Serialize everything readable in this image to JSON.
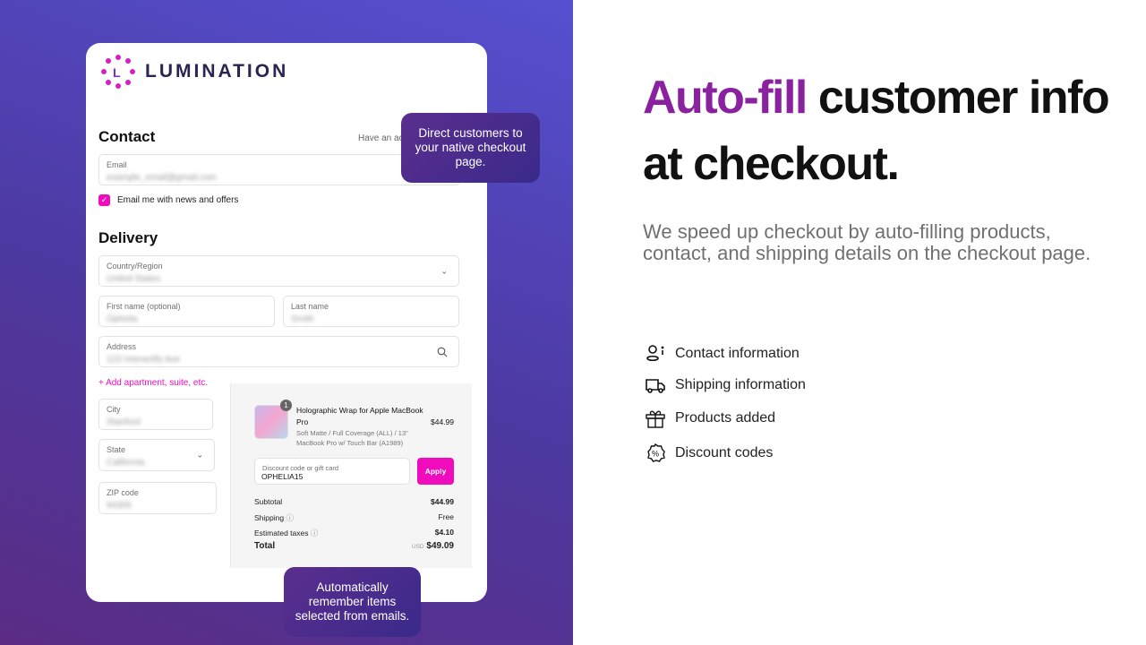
{
  "brand": {
    "name": "LUMINATION",
    "color": "#e020c8"
  },
  "checkout": {
    "contact_title": "Contact",
    "have_account": "Have an ac",
    "email": {
      "label": "Email",
      "value": "example_email@gmail.com"
    },
    "newsletter": {
      "label": "Email me with news and offers",
      "checked": true
    },
    "delivery_title": "Delivery",
    "country": {
      "label": "Country/Region",
      "value": "United States"
    },
    "first_name": {
      "label": "First name (optional)",
      "value": "Ophelia"
    },
    "last_name": {
      "label": "Last name",
      "value": "Smith"
    },
    "address": {
      "label": "Address",
      "value": "123 Interactify Ave"
    },
    "add_apartment": "+ Add apartment, suite, etc.",
    "city": {
      "label": "City",
      "value": "Stanford"
    },
    "state": {
      "label": "State",
      "value": "California"
    },
    "zip": {
      "label": "ZIP code",
      "value": "94305"
    }
  },
  "summary": {
    "product": {
      "quantity": "1",
      "name": "Holographic Wrap for Apple MacBook Pro",
      "variant": "Soft Matte / Full Coverage (ALL) / 13\" MacBook Pro w/ Touch Bar (A1989)",
      "price": "$44.99"
    },
    "discount": {
      "label": "Discount code or gift card",
      "value": "OPHELIA15",
      "apply": "Apply"
    },
    "subtotal": {
      "label": "Subtotal",
      "value": "$44.99"
    },
    "shipping": {
      "label": "Shipping",
      "value": "Free"
    },
    "taxes": {
      "label": "Estimated taxes",
      "value": "$4.10"
    },
    "total": {
      "label": "Total",
      "currency": "USD",
      "value": "$49.09"
    }
  },
  "tooltips": {
    "native": "Direct customers to your native checkout page.",
    "remember": "Automatically remember items selected from emails."
  },
  "hero": {
    "headline_accent": "Auto-fill",
    "headline_rest": " customer info at checkout.",
    "subtitle": "We speed up checkout by auto-filling products, contact, and shipping details on the checkout page.",
    "features": [
      {
        "icon": "contact-icon",
        "label": "Contact information"
      },
      {
        "icon": "truck-icon",
        "label": "Shipping information"
      },
      {
        "icon": "gift-icon",
        "label": "Products added"
      },
      {
        "icon": "discount-icon",
        "label": "Discount codes"
      }
    ]
  },
  "colors": {
    "accent": "#8a22a0",
    "pink": "#f00cbc",
    "tooltip": "#4a2c8c"
  }
}
